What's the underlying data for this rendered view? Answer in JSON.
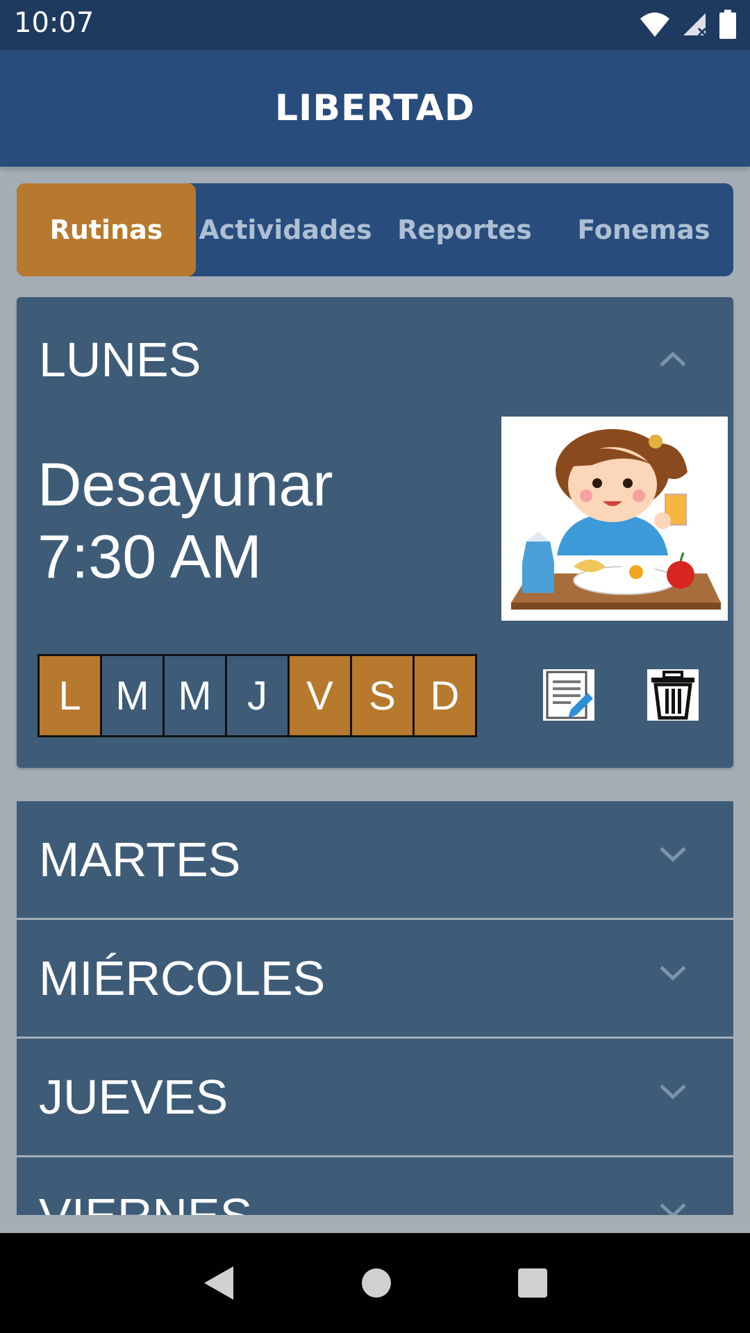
{
  "status_bar": {
    "time": "10:07",
    "icons": [
      "wifi-icon",
      "signal-icon",
      "battery-icon"
    ]
  },
  "app_bar": {
    "title": "LIBERTAD"
  },
  "tabs": [
    {
      "label": "Rutinas",
      "active": true
    },
    {
      "label": "Actividades",
      "active": false
    },
    {
      "label": "Reportes",
      "active": false
    },
    {
      "label": "Fonemas",
      "active": false
    }
  ],
  "expanded_day": {
    "name": "LUNES",
    "routine": {
      "name": "Desayunar",
      "time": "7:30 AM",
      "image": "girl-eating-breakfast-image",
      "days": [
        {
          "letter": "L",
          "selected": true
        },
        {
          "letter": "M",
          "selected": false
        },
        {
          "letter": "M",
          "selected": false
        },
        {
          "letter": "J",
          "selected": false
        },
        {
          "letter": "V",
          "selected": true
        },
        {
          "letter": "S",
          "selected": true
        },
        {
          "letter": "D",
          "selected": true
        }
      ],
      "actions": [
        "edit-icon",
        "trash-icon"
      ]
    }
  },
  "collapsed_days": [
    "MARTES",
    "MIÉRCOLES",
    "JUEVES",
    "VIERNES"
  ],
  "colors": {
    "primary": "#284d7c",
    "accent": "#b7792d",
    "card": "#3e5c78",
    "background": "#a4adb6"
  },
  "nav_bar": [
    "back-icon",
    "home-icon",
    "recents-icon"
  ]
}
